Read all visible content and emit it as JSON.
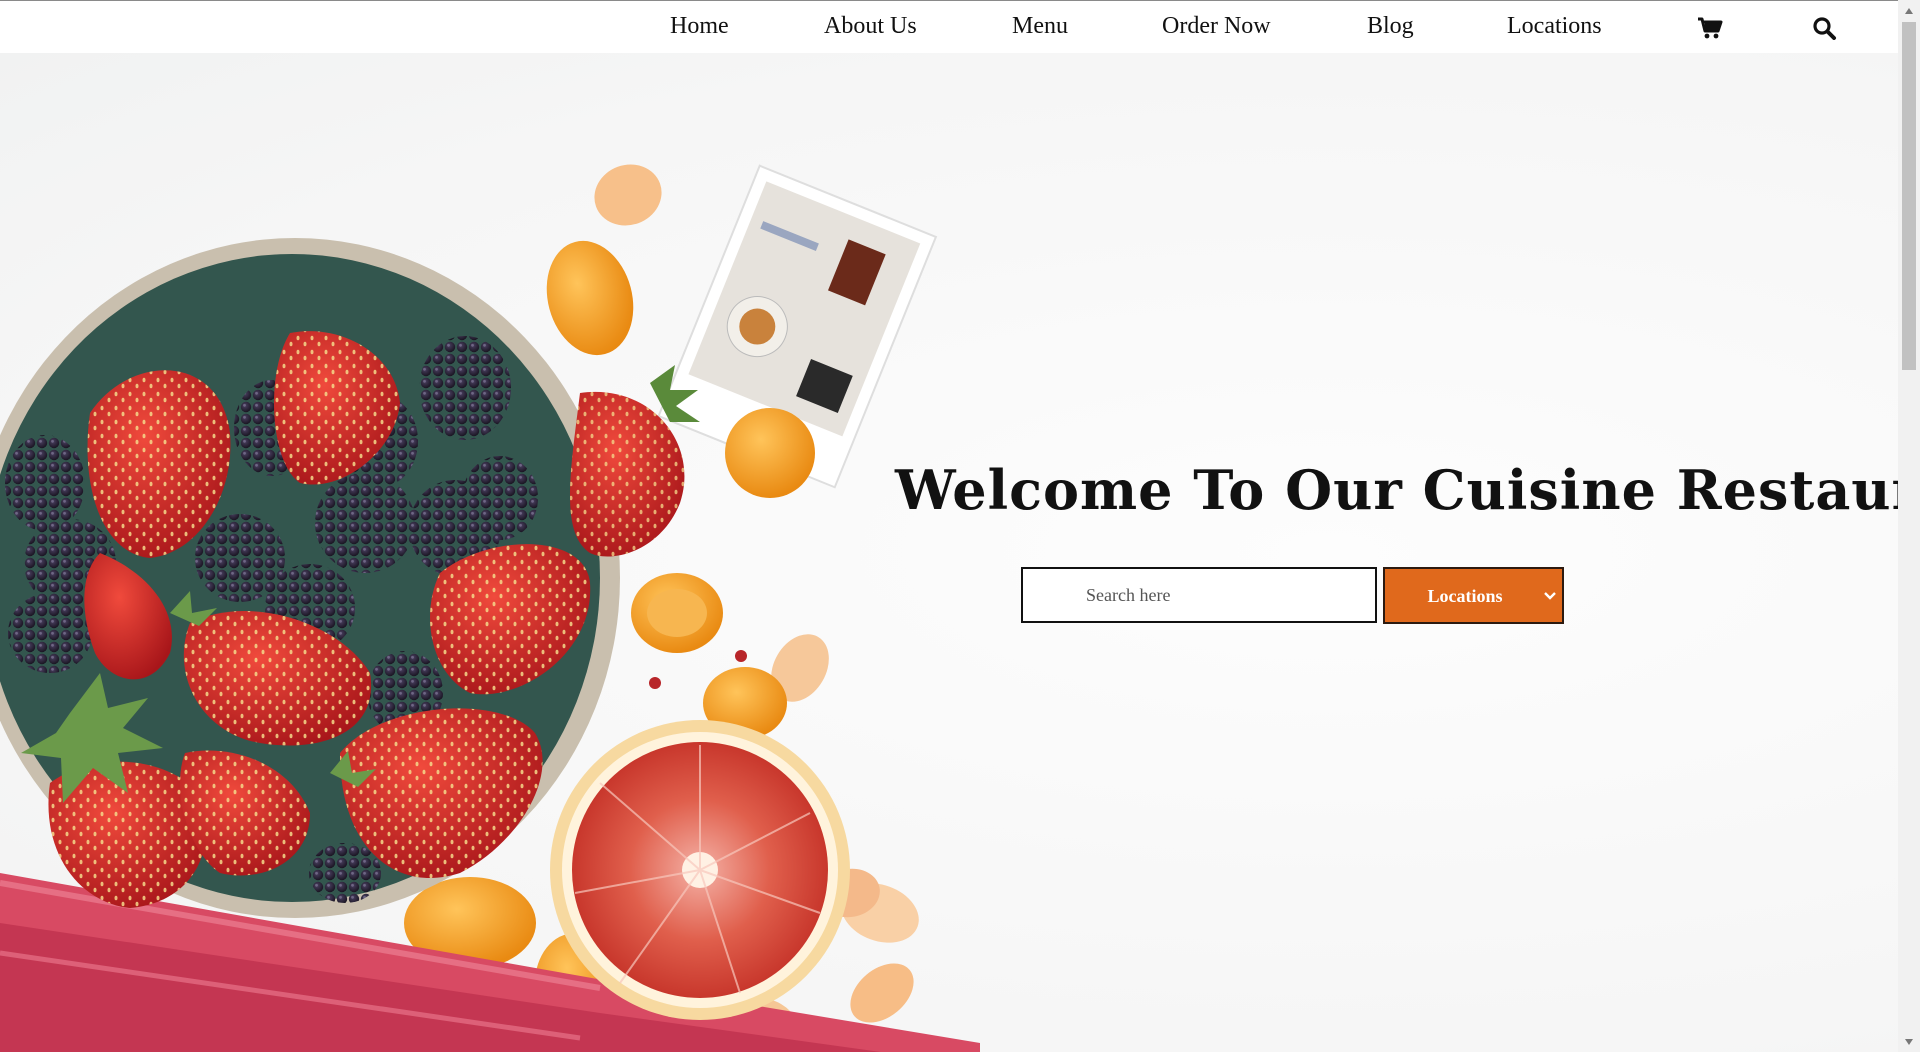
{
  "nav": {
    "items": [
      {
        "label": "Home"
      },
      {
        "label": "About Us"
      },
      {
        "label": "Menu"
      },
      {
        "label": "Order Now"
      },
      {
        "label": "Blog"
      },
      {
        "label": "Locations"
      }
    ],
    "cart_icon": "shopping-cart-icon",
    "search_icon": "magnifier-search-icon"
  },
  "hero": {
    "title": "Welcome To Our Cuisine Restaurant",
    "search": {
      "placeholder": "Search here",
      "value": ""
    },
    "location_select": {
      "selected": "Locations",
      "icon": "chevron-down-icon"
    },
    "accent_color": "#e0691c",
    "image_subject": "fruit-bowl"
  },
  "scrollbar": {
    "position": 0.02
  }
}
